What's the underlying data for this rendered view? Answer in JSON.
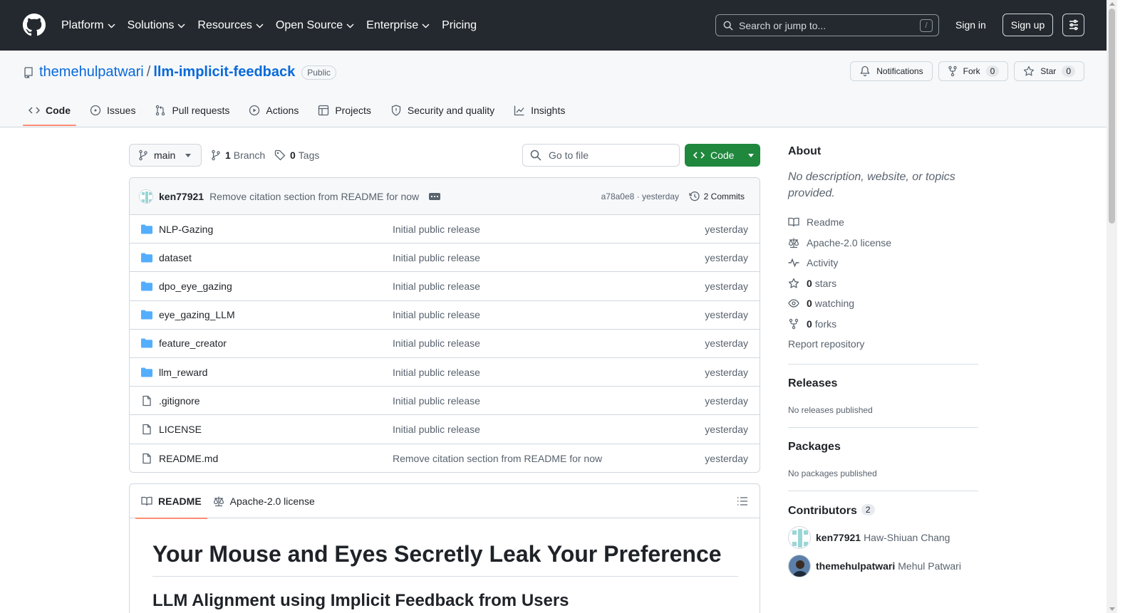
{
  "header": {
    "nav": [
      "Platform",
      "Solutions",
      "Resources",
      "Open Source",
      "Enterprise",
      "Pricing"
    ],
    "search_placeholder": "Search or jump to...",
    "search_shortcut": "/",
    "signin": "Sign in",
    "signup": "Sign up"
  },
  "repo": {
    "owner": "themehulpatwari",
    "separator": "/",
    "name": "llm-implicit-feedback",
    "visibility": "Public",
    "notifications_label": "Notifications",
    "fork_label": "Fork",
    "fork_count": "0",
    "star_label": "Star",
    "star_count": "0",
    "tabs": [
      "Code",
      "Issues",
      "Pull requests",
      "Actions",
      "Projects",
      "Security and quality",
      "Insights"
    ]
  },
  "browser": {
    "branch": "main",
    "branch_count": "1",
    "branch_label": "Branch",
    "tag_count": "0",
    "tag_label": "Tags",
    "goto_placeholder": "Go to file",
    "code_button": "Code",
    "commit": {
      "author": "ken77921",
      "message": "Remove citation section from README for now",
      "hash_time": "a78a0e8 · yesterday",
      "commits_label": "2 Commits"
    },
    "files": [
      {
        "name": "NLP-Gazing",
        "type": "dir",
        "message": "Initial public release",
        "time": "yesterday"
      },
      {
        "name": "dataset",
        "type": "dir",
        "message": "Initial public release",
        "time": "yesterday"
      },
      {
        "name": "dpo_eye_gazing",
        "type": "dir",
        "message": "Initial public release",
        "time": "yesterday"
      },
      {
        "name": "eye_gazing_LLM",
        "type": "dir",
        "message": "Initial public release",
        "time": "yesterday"
      },
      {
        "name": "feature_creator",
        "type": "dir",
        "message": "Initial public release",
        "time": "yesterday"
      },
      {
        "name": "llm_reward",
        "type": "dir",
        "message": "Initial public release",
        "time": "yesterday"
      },
      {
        "name": ".gitignore",
        "type": "file",
        "message": "Initial public release",
        "time": "yesterday"
      },
      {
        "name": "LICENSE",
        "type": "file",
        "message": "Initial public release",
        "time": "yesterday"
      },
      {
        "name": "README.md",
        "type": "file",
        "message": "Remove citation section from README for now",
        "time": "yesterday"
      }
    ]
  },
  "readme": {
    "tab_readme": "README",
    "tab_license": "Apache-2.0 license",
    "h1": "Your Mouse and Eyes Secretly Leak Your Preference",
    "h2": "LLM Alignment using Implicit Feedback from Users"
  },
  "sidebar": {
    "about_title": "About",
    "about_desc": "No description, website, or topics provided.",
    "links": [
      {
        "icon": "book-icon",
        "count": "",
        "label": "Readme"
      },
      {
        "icon": "scale-icon",
        "count": "",
        "label": "Apache-2.0 license"
      },
      {
        "icon": "pulse-icon",
        "count": "",
        "label": "Activity"
      },
      {
        "icon": "star-icon",
        "count": "0",
        "label": "stars"
      },
      {
        "icon": "eye-icon",
        "count": "0",
        "label": "watching"
      },
      {
        "icon": "fork-icon",
        "count": "0",
        "label": "forks"
      }
    ],
    "report": "Report repository",
    "releases_title": "Releases",
    "releases_text": "No releases published",
    "packages_title": "Packages",
    "packages_text": "No packages published",
    "contributors_title": "Contributors",
    "contributors_count": "2",
    "contributors": [
      {
        "login": "ken77921",
        "name": "Haw-Shiuan Chang"
      },
      {
        "login": "themehulpatwari",
        "name": "Mehul Patwari"
      }
    ]
  },
  "colors": {
    "header_bg": "#24292f",
    "link": "#0969da",
    "primary_button": "#1f883d",
    "folder": "#54aeff",
    "tab_underline": "#fd8c73"
  }
}
